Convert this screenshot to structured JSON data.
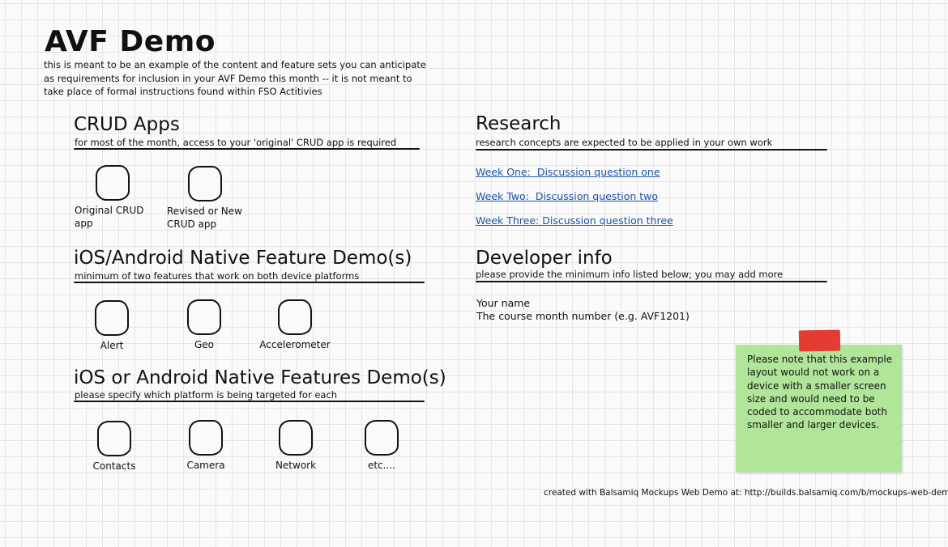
{
  "page": {
    "title": "AVF Demo",
    "intro_lines": [
      "this is meant to be an example of the content and feature sets you can anticipate",
      "as requirements for inclusion in your AVF Demo this month -- it is not meant to",
      "take place of formal instructions found within FSO Actitivies"
    ]
  },
  "crud": {
    "title": "CRUD Apps",
    "subtitle": "for most of the month, access to your 'original' CRUD app is required",
    "items": [
      {
        "label_lines": [
          "Original CRUD",
          "app"
        ],
        "icon": "app-icon"
      },
      {
        "label_lines": [
          "Revised or New",
          "CRUD app"
        ],
        "icon": "app-icon"
      }
    ]
  },
  "native_both": {
    "title": "iOS/Android Native Feature Demo(s)",
    "subtitle": "minimum of two features that work on both device platforms",
    "items": [
      {
        "label": "Alert",
        "icon": "app-icon"
      },
      {
        "label": "Geo",
        "icon": "app-icon"
      },
      {
        "label": "Accelerometer",
        "icon": "app-icon"
      }
    ]
  },
  "native_either": {
    "title": "iOS or Android Native Features Demo(s)",
    "subtitle": "please specify which platform is being targeted for each",
    "items": [
      {
        "label": "Contacts",
        "icon": "app-icon"
      },
      {
        "label": "Camera",
        "icon": "app-icon"
      },
      {
        "label": "Network",
        "icon": "app-icon"
      },
      {
        "label": "etc....",
        "icon": "app-icon"
      }
    ]
  },
  "research": {
    "title": "Research",
    "subtitle": "research concepts are expected to be applied in your own work",
    "links": [
      "Week One:  Discussion question one",
      "Week Two:  Discussion question two",
      "Week Three: Discussion question three"
    ]
  },
  "developer": {
    "title": "Developer info",
    "subtitle": "please provide the minimum info listed below; you may add more",
    "fields": [
      "Your name",
      "The course month number (e.g. AVF1201)"
    ]
  },
  "note": {
    "lines": [
      "Please note that this example",
      "layout would not work on a",
      "device with a smaller screen",
      "size and would need to be",
      "coded to accommodate both",
      "smaller and larger devices."
    ],
    "background_color": "#b1e59a",
    "tape_color": "#e23c33"
  },
  "footer": {
    "text": "created with Balsamiq Mockups Web Demo at: http://builds.balsamiq.com/b/mockups-web-demo/"
  },
  "colors": {
    "link": "#1a55a8",
    "grid": "#e6e6e6",
    "ink": "#111111"
  }
}
